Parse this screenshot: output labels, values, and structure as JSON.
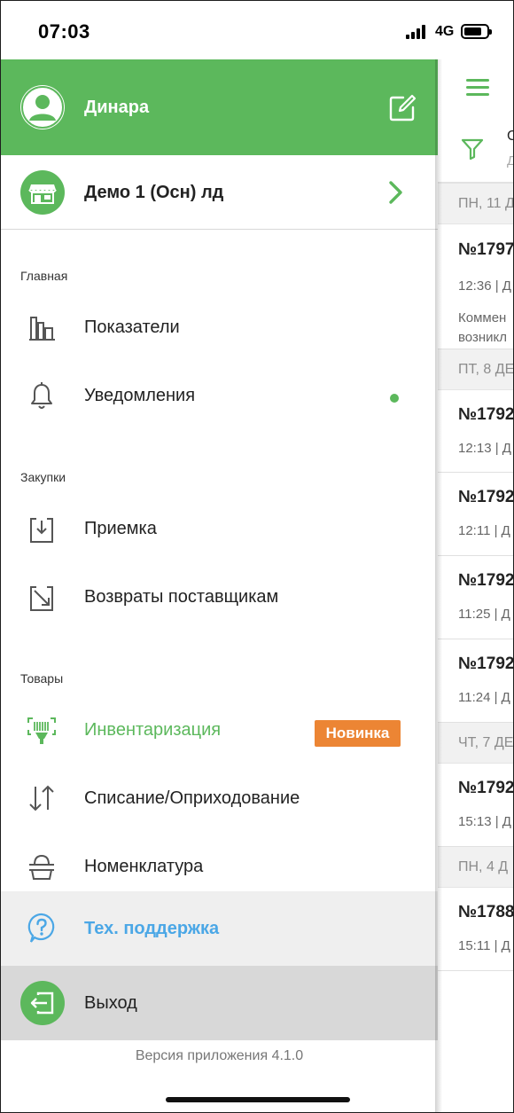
{
  "status_bar": {
    "time": "07:03",
    "network": "4G"
  },
  "drawer": {
    "user_name": "Динара",
    "store_name": "Демо 1 (Осн) лд",
    "sections": {
      "main": "Главная",
      "purchases": "Закупки",
      "goods": "Товары"
    },
    "items": {
      "indicators": "Показатели",
      "notifications": "Уведомления",
      "receiving": "Приемка",
      "supplier_returns": "Возвраты поставщикам",
      "inventory": "Инвентаризация",
      "inventory_badge": "Новинка",
      "writeoff": "Списание/Оприходование",
      "nomenclature": "Номенклатура",
      "support": "Тех. поддержка",
      "logout": "Выход"
    },
    "version": "Версия приложения 4.1.0"
  },
  "background_list": {
    "filter_text": "С",
    "filter_sub": "Д",
    "groups": [
      {
        "date": "ПН, 11 Д",
        "docs": [
          {
            "number": "№1797",
            "meta": "12:36 | Д",
            "comment": [
              "Коммен",
              "возникл"
            ]
          }
        ]
      },
      {
        "date": "ПТ, 8 ДЕ",
        "docs": [
          {
            "number": "№1792",
            "meta": "12:13 | Д"
          },
          {
            "number": "№1792",
            "meta": "12:11 | Д"
          },
          {
            "number": "№1792",
            "meta": "11:25 | Д"
          },
          {
            "number": "№1792",
            "meta": "11:24 | Д"
          }
        ]
      },
      {
        "date": "ЧТ, 7 ДЕ",
        "docs": [
          {
            "number": "№1792",
            "meta": "15:13 | Д"
          }
        ]
      },
      {
        "date": "ПН, 4 Д",
        "docs": [
          {
            "number": "№1788",
            "meta": "15:11 | Д"
          }
        ]
      }
    ]
  },
  "colors": {
    "accent_green": "#5cb85c",
    "badge_orange": "#ec8534",
    "support_blue": "#4ba7e6",
    "highlight_red": "#e02027"
  }
}
